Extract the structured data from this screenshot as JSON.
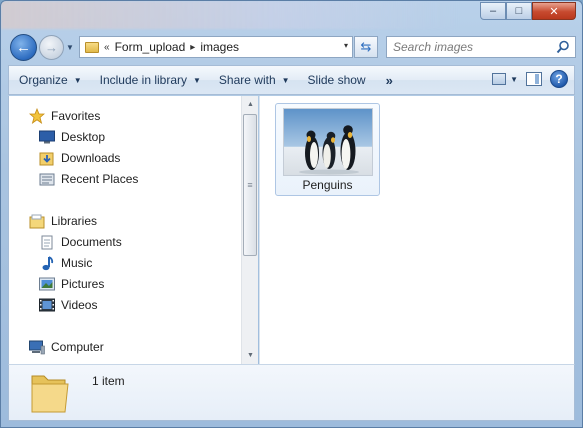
{
  "window": {
    "controls": {
      "minimize": "–",
      "maximize": "□",
      "close": "✕"
    }
  },
  "address": {
    "overflow_chevron": "«",
    "crumbs": [
      "Form_upload",
      "images"
    ],
    "separator": "▸",
    "dropdown": "▾"
  },
  "search": {
    "placeholder": "Search images"
  },
  "toolbar": {
    "organize": "Organize",
    "include_in_library": "Include in library",
    "share_with": "Share with",
    "slide_show": "Slide show",
    "more": "»",
    "help": "?"
  },
  "nav": {
    "favorites": {
      "label": "Favorites",
      "items": [
        "Desktop",
        "Downloads",
        "Recent Places"
      ]
    },
    "libraries": {
      "label": "Libraries",
      "items": [
        "Documents",
        "Music",
        "Pictures",
        "Videos"
      ]
    },
    "computer": {
      "label": "Computer"
    }
  },
  "files": [
    {
      "name": "Penguins",
      "icon": "image-thumbnail"
    }
  ],
  "details": {
    "count": "1 item"
  },
  "colors": {
    "accent": "#1e395b",
    "close_button": "#c74a2f",
    "selection_border": "#aec6e4"
  }
}
